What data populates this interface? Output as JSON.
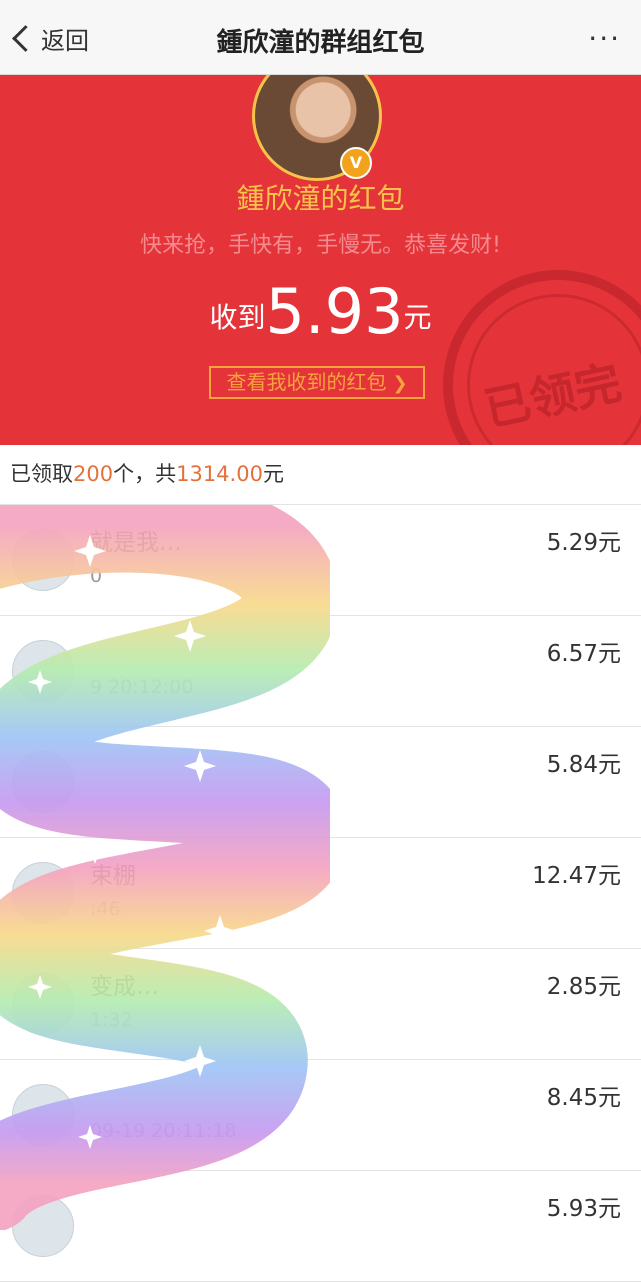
{
  "nav": {
    "back_label": "返回",
    "title": "鍾欣潼的群组红包",
    "more_label": "···"
  },
  "hero": {
    "sender": "鍾欣潼的红包",
    "blessing": "快来抢，手快有，手慢无。恭喜发财!",
    "received_prefix": "收到",
    "amount": "5.93",
    "amount_unit": "元",
    "view_button": "查看我收到的红包",
    "stamp_text": "已领完",
    "badge": "V"
  },
  "summary": {
    "pre": "已领取",
    "count": "200",
    "mid": "个，共",
    "total": "1314.00",
    "unit": "元"
  },
  "rows": [
    {
      "name": "就是我…",
      "time": "0",
      "amount": "5.29元"
    },
    {
      "name": "",
      "time": "9 20:12:00",
      "amount": "6.57元"
    },
    {
      "name": "",
      "time": "",
      "amount": "5.84元"
    },
    {
      "name": "束棚",
      "time": ":46",
      "amount": "12.47元"
    },
    {
      "name": "变成…",
      "time": "1:32",
      "amount": "2.85元"
    },
    {
      "name": "",
      "time": "09-19 20:11:18",
      "amount": "8.45元"
    },
    {
      "name": "",
      "time": "",
      "amount": "5.93元"
    }
  ]
}
